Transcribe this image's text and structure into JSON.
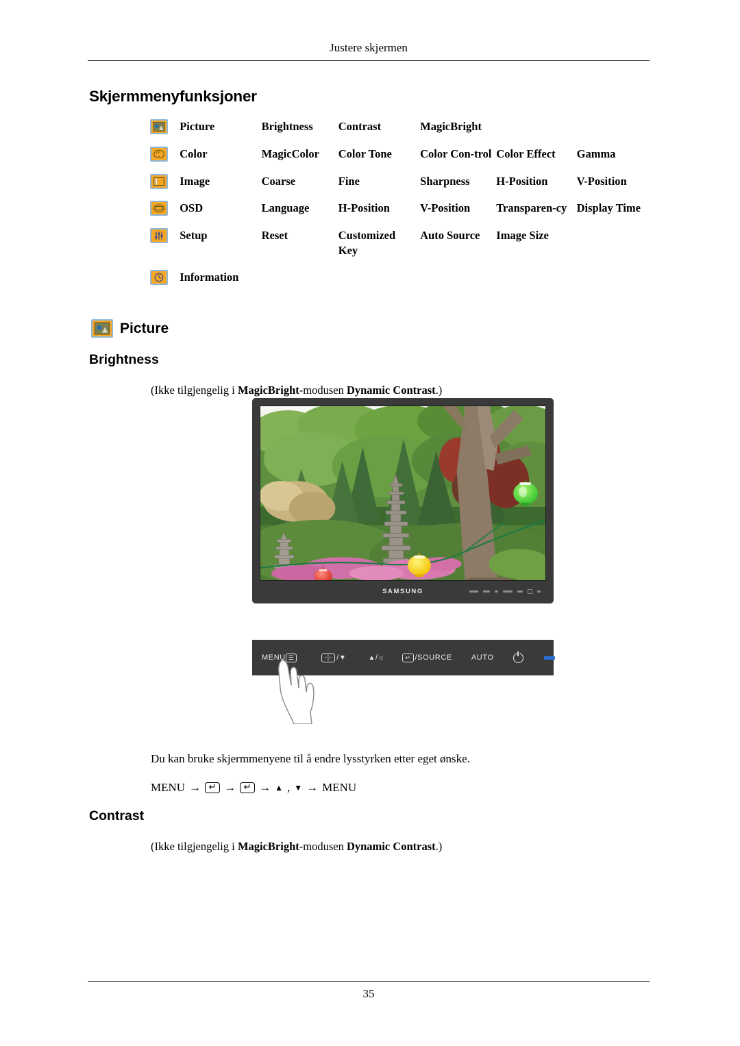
{
  "header": {
    "running_title": "Justere skjermen"
  },
  "page_title": "Skjermmenyfunksjoner",
  "menu_table": {
    "rows": [
      {
        "icon": "picture-icon",
        "category": "Picture",
        "items": [
          "Brightness",
          "Contrast",
          "MagicBright",
          "",
          ""
        ]
      },
      {
        "icon": "color-palette-icon",
        "category": "Color",
        "items": [
          "MagicColor",
          "Color Tone",
          "Color Con-trol",
          "Color Effect",
          "Gamma"
        ]
      },
      {
        "icon": "image-frame-icon",
        "category": "Image",
        "items": [
          "Coarse",
          "Fine",
          "Sharpness",
          "H-Position",
          "V-Position"
        ]
      },
      {
        "icon": "osd-icon",
        "category": "OSD",
        "items": [
          "Language",
          "H-Position",
          "V-Position",
          "Transparen-cy",
          "Display Time"
        ]
      },
      {
        "icon": "setup-sliders-icon",
        "category": "Setup",
        "items": [
          "Reset",
          "Customized Key",
          "Auto Source",
          "Image Size",
          ""
        ]
      },
      {
        "icon": "information-clock-icon",
        "category": "Information",
        "items": [
          "",
          "",
          "",
          "",
          ""
        ]
      }
    ]
  },
  "sections": {
    "picture": {
      "icon": "picture-icon",
      "label": "Picture"
    },
    "brightness": {
      "heading": "Brightness",
      "note_prefix": "(Ikke tilgjengelig i ",
      "note_bold_1": "MagicBright",
      "note_mid": "-modusen ",
      "note_bold_2": "Dynamic Contrast",
      "note_suffix": ".)",
      "description": "Du kan bruke skjermmenyene til å endre lysstyrken etter eget ønske.",
      "path_start": "MENU",
      "path_arrow": "→",
      "path_up": "▲",
      "path_comma": ",",
      "path_down": "▼",
      "path_end": "MENU"
    },
    "contrast": {
      "heading": "Contrast",
      "note_prefix": "(Ikke tilgjengelig i ",
      "note_bold_1": "MagicBright",
      "note_mid": "-modusen ",
      "note_bold_2": "Dynamic Contrast",
      "note_suffix": ".)"
    }
  },
  "monitor_figure": {
    "brand_logo": "SAMSUNG",
    "photo_description": "Hagemotiv med steinpagoder, grønne trær, rosa blomster og røde, gule og grønne lykter"
  },
  "control_panel": {
    "buttons": [
      {
        "label": "MENU",
        "glyph": "menu-icon"
      },
      {
        "label": "/",
        "left_glyph": "plus-box-icon",
        "right_glyph": "▼"
      },
      {
        "label": "/",
        "left_glyph": "▲",
        "right_glyph": "brightness-sun-icon"
      },
      {
        "label": "/SOURCE",
        "left_glyph": "enter-box-icon"
      },
      {
        "label": "AUTO"
      },
      {
        "label": "",
        "glyph": "power-icon"
      },
      {
        "label": "",
        "glyph": "led-indicator"
      }
    ],
    "pointer": "hand-pointing-icon"
  },
  "colors": {
    "icon_fill": "#f5a623",
    "icon_border": "#8fb8dd",
    "bezel": "#3a3a3a",
    "led": "#2a6fd4"
  },
  "footer": {
    "page_number": "35"
  }
}
